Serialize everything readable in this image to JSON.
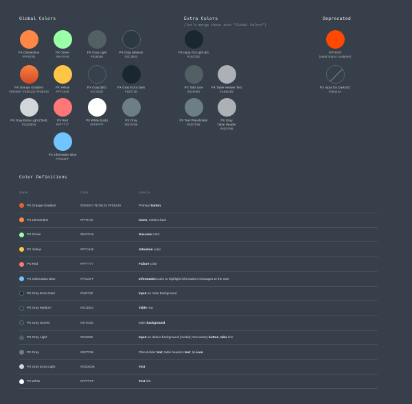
{
  "sections": {
    "global": "Global Colors",
    "extra": "Extra Colors",
    "extra_sub": "(let's merge those into \"Global Colors\")",
    "deprecated": "Deprecated",
    "definitions": "Color Definitions"
  },
  "global_swatches": [
    {
      "name": "PX Clementine",
      "code": "#FF8746",
      "color": "#ff8746"
    },
    {
      "name": "PX Green",
      "code": "#9AFFA6",
      "color": "#9affa6"
    },
    {
      "name": "PX Gray Light",
      "code": "#526066",
      "color": "#526066"
    },
    {
      "name": "PX Gray Medium",
      "code": "#2C3842",
      "color": "#2c3842"
    },
    {
      "name": "PX Orange Gradient",
      "code": "#D54927 #E36132 #F58240",
      "color": "linear-gradient(180deg,#f58240,#d54927)"
    },
    {
      "name": "PX Yellow",
      "code": "#FFC646",
      "color": "#ffc646"
    },
    {
      "name": "PX Gray (BG)",
      "code": "#37404D",
      "color": "#37404d"
    },
    {
      "name": "PX Gray Extra Dark",
      "code": "#19272E",
      "color": "#19272e"
    },
    {
      "name": "PX Gray Extra Light (Text)",
      "code": "#D3D6D8",
      "color": "#d3d6d8"
    },
    {
      "name": "PX Red",
      "code": "#FF7777",
      "color": "#ff7777"
    },
    {
      "name": "PX White (Link)",
      "code": "#FFFFFF",
      "color": "#ffffff"
    },
    {
      "name": "PX Gray",
      "code": "#6D7F86",
      "color": "#6d7f86"
    },
    {
      "name": "PX Information Blue",
      "code": "#70C5FF",
      "color": "#70c5ff"
    }
  ],
  "extra_swatches": [
    {
      "name": "PX Input On Light BG",
      "code": "#19272E",
      "color": "#19272e"
    },
    {
      "name": "PX Tabs Line",
      "code": "#526066",
      "color": "#526066"
    },
    {
      "name": "PX Table Header Text",
      "code": "#ABB1B5",
      "color": "#abb1b5"
    },
    {
      "name": "PX Text Placeholder",
      "code": "#6D7F86",
      "color": "#6d7f86"
    },
    {
      "name": "PX Gray",
      "name2": "Table Header",
      "code": "#6D7F86",
      "color": "#abb1b5"
    }
  ],
  "deprecated_swatches": [
    {
      "code": "#FF4800",
      "note": "(used only in Analyser)",
      "color": "#ff4800"
    },
    {
      "name": "PX Input On Dark BG",
      "code": "#35444A",
      "color": "#37404a"
    }
  ],
  "table": {
    "headers": {
      "name": "Name",
      "code": "Code",
      "used": "Used in"
    },
    "rows": [
      {
        "name": "PX Orange Gradient",
        "code": "#D54927 #E36132 #F58240",
        "color": "#e36132",
        "used": [
          {
            "t": "Primary "
          },
          {
            "b": "button"
          }
        ]
      },
      {
        "name": "PX Clementine",
        "code": "#FF8746",
        "color": "#ff8746",
        "used": [
          {
            "b": "Icons"
          },
          {
            "t": ", metrics bars"
          }
        ]
      },
      {
        "name": "PX Green",
        "code": "#9AFFA6",
        "color": "#9affa6",
        "used": [
          {
            "b": "Success"
          },
          {
            "t": " color"
          }
        ]
      },
      {
        "name": "PX Yellow",
        "code": "#FFC646",
        "color": "#ffc646",
        "used": [
          {
            "b": "Attention"
          },
          {
            "t": " color"
          }
        ]
      },
      {
        "name": "PX Red",
        "code": "#FF7777",
        "color": "#ff7777",
        "used": [
          {
            "b": "Failure"
          },
          {
            "t": " color"
          }
        ]
      },
      {
        "name": "PX Information Blue",
        "code": "#70C5FF",
        "color": "#70c5ff",
        "used": [
          {
            "b": "Information"
          },
          {
            "t": " color to highlight information messages to the user"
          }
        ]
      },
      {
        "name": "PX Gray Extra Dark",
        "code": "#19272E",
        "color": "#19272e",
        "used": [
          {
            "b": "Input"
          },
          {
            "t": " on main background"
          }
        ]
      },
      {
        "name": "PX Gray Medium",
        "code": "#2C3842",
        "color": "#2c3842",
        "used": [
          {
            "b": "Table"
          },
          {
            "t": " row"
          }
        ]
      },
      {
        "name": "PX Gray Screen",
        "code": "#37404D",
        "color": "#37404d",
        "used": [
          {
            "t": "Main "
          },
          {
            "b": "background"
          }
        ]
      },
      {
        "name": "PX Gray Light",
        "code": "#526066",
        "color": "#526066",
        "used": [
          {
            "b": "Input"
          },
          {
            "t": " on darker background (modal); Secondary "
          },
          {
            "b": "button"
          },
          {
            "t": ", "
          },
          {
            "b": "tabs"
          },
          {
            "t": " line"
          }
        ]
      },
      {
        "name": "PX Gray",
        "code": "#6D7F86",
        "color": "#6d7f86",
        "used": [
          {
            "t": "Placeholder "
          },
          {
            "b": "text"
          },
          {
            "t": "; table headers "
          },
          {
            "b": "text"
          },
          {
            "t": "; tip "
          },
          {
            "b": "icon"
          }
        ]
      },
      {
        "name": "PX Gray Extra Light",
        "code": "#D3D6D8",
        "color": "#d3d6d8",
        "used": [
          {
            "b": "Text"
          }
        ]
      },
      {
        "name": "PX White",
        "code": "#FFFFFF",
        "color": "#ffffff",
        "used": [
          {
            "b": "Text"
          },
          {
            "t": " link"
          }
        ]
      }
    ]
  }
}
